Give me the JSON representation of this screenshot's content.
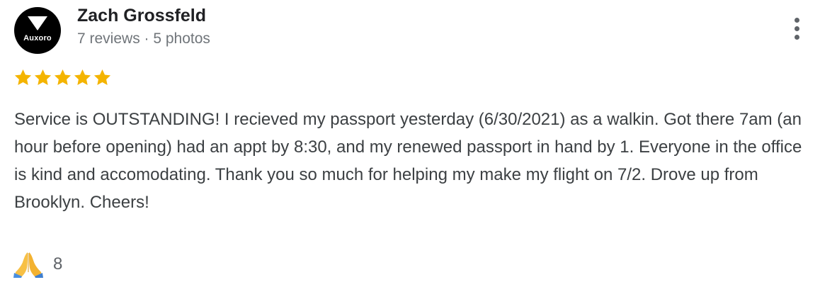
{
  "reviewer": {
    "name": "Zach Grossfeld",
    "avatar_text": "Auxoro",
    "meta": "7 reviews · 5 photos"
  },
  "rating": {
    "stars": 5,
    "max": 5,
    "star_color": "#f4b400"
  },
  "review": {
    "text": "Service is OUTSTANDING! I recieved my passport yesterday (6/30/2021) as a walkin. Got there 7am (an hour before opening) had an appt by 8:30, and my renewed passport in hand by 1. Everyone in the office is kind and accomodating. Thank you so much for helping my make my flight on 7/2. Drove up from Brooklyn. Cheers!"
  },
  "reaction": {
    "icon": "folded-hands-icon",
    "count": "8"
  },
  "menu": {
    "icon": "more-vertical-icon"
  }
}
